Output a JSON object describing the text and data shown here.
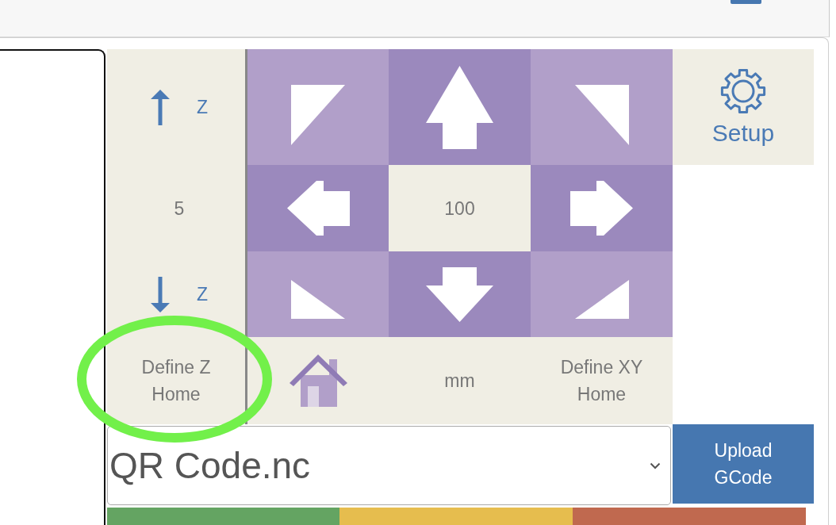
{
  "z_jog": {
    "up_axis": "Z",
    "step": "5",
    "down_axis": "Z",
    "home_button": "Define Z Home"
  },
  "xy_jog": {
    "step": "100",
    "unit": "mm",
    "home_button": "Define XY Home"
  },
  "setup_button": {
    "label": "Setup"
  },
  "file_select": {
    "value": "QR Code.nc"
  },
  "upload_button": {
    "label": "Upload GCode"
  },
  "status_bars": [
    {
      "color": "#64a462"
    },
    {
      "color": "#e6bd4e"
    },
    {
      "color": "#c0694f"
    }
  ]
}
